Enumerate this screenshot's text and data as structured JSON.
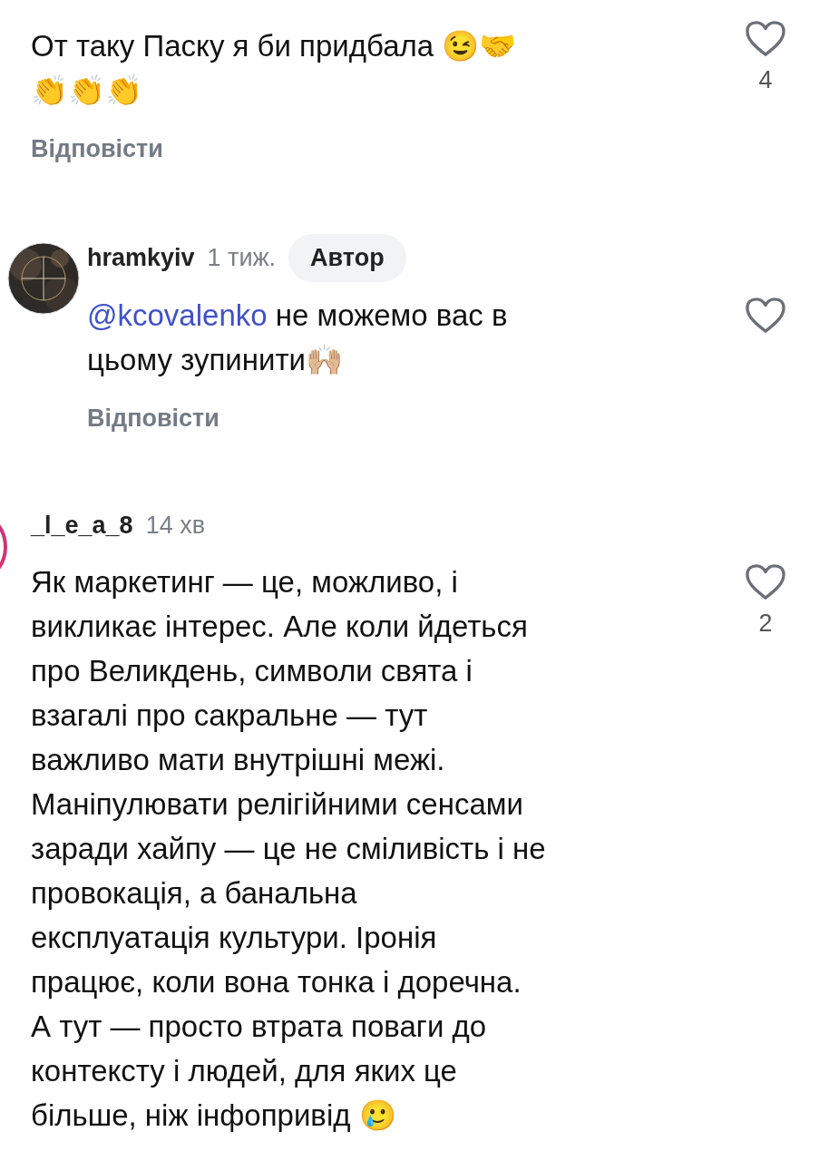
{
  "comments": [
    {
      "kind": "comment",
      "story_ring": false,
      "lines": [
        {
          "text": "От таку Паску я би придбала 😉🤝"
        },
        {
          "text": "👏👏👏"
        }
      ],
      "reply_label": "Відповісти",
      "liked": false,
      "likes": "4"
    },
    {
      "kind": "reply",
      "avatar": {
        "kind": "picture"
      },
      "username": "hramkyiv",
      "time": "1 тиж.",
      "badge": "Автор",
      "lines": [
        {
          "mention": "@kcovalenko",
          "text": "не можемо вас в"
        },
        {
          "text": "цьому зупинити🙌🏼"
        }
      ],
      "reply_label": "Відповісти",
      "liked": false
    },
    {
      "kind": "comment",
      "story_ring": true,
      "username": "_l_e_a_8",
      "time": "14 хв",
      "lines": [
        {
          "text": "Як маркетинг — це, можливо, і"
        },
        {
          "text": "викликає інтерес. Але коли йдеться"
        },
        {
          "text": "про Великдень, символи свята і"
        },
        {
          "text": "взагалі про сакральне — тут"
        },
        {
          "text": "важливо мати внутрішні межі."
        },
        {
          "text": "Маніпулювати релігійними сенсами"
        },
        {
          "text": "заради хайпу — це не сміливість і не"
        },
        {
          "text": "провокація, а банальна"
        },
        {
          "text": "експлуатація культури. Іронія"
        },
        {
          "text": "працює, коли вона тонка і доречна."
        },
        {
          "text": "А тут — просто втрата поваги до"
        },
        {
          "text": "контексту і людей, для яких це"
        },
        {
          "text": "більше, ніж інфопривід 🥲"
        }
      ],
      "liked": false,
      "likes": "2"
    }
  ]
}
